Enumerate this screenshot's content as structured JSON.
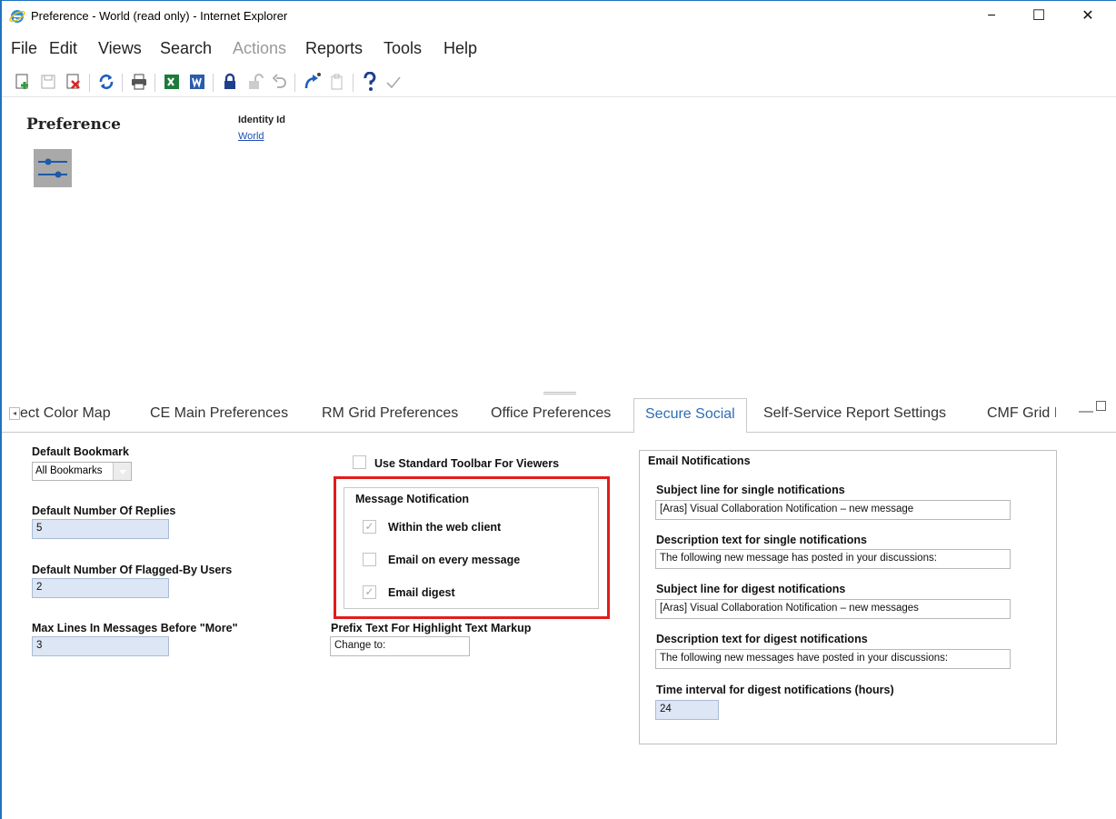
{
  "window": {
    "title": "Preference - World (read only) - Internet Explorer",
    "minimize": "−",
    "maximize": "☐",
    "close": "✕"
  },
  "menu": {
    "file": "File",
    "edit": "Edit",
    "views": "Views",
    "search": "Search",
    "actions": "Actions",
    "reports": "Reports",
    "tools": "Tools",
    "help": "Help"
  },
  "header": {
    "title": "Preference",
    "identity_label": "Identity Id",
    "identity_value": "World"
  },
  "tabs": [
    {
      "label": "ect Color Map"
    },
    {
      "label": "CE Main Preferences"
    },
    {
      "label": "RM Grid Preferences"
    },
    {
      "label": "Office Preferences"
    },
    {
      "label": "Secure Social",
      "active": true
    },
    {
      "label": "Self-Service Report Settings"
    },
    {
      "label": "CMF Grid I"
    }
  ],
  "pane_controls": {
    "minimize": "—"
  },
  "form": {
    "default_bookmark": {
      "label": "Default Bookmark",
      "value": "All Bookmarks"
    },
    "default_replies": {
      "label": "Default Number Of Replies",
      "value": "5"
    },
    "default_flagged": {
      "label": "Default Number Of Flagged-By Users",
      "value": "2"
    },
    "max_lines": {
      "label": "Max Lines In Messages Before \"More\"",
      "value": "3"
    },
    "use_standard_toolbar": {
      "label": "Use Standard Toolbar For Viewers",
      "checked": false
    },
    "message_notification": {
      "label": "Message Notification",
      "within_web_client": {
        "label": "Within the web client",
        "checked": true
      },
      "email_every_message": {
        "label": "Email on every message",
        "checked": false
      },
      "email_digest": {
        "label": "Email digest",
        "checked": true
      }
    },
    "prefix_text": {
      "label": "Prefix Text For Highlight Text Markup",
      "value": "Change to:"
    },
    "email_notifications": {
      "label": "Email Notifications",
      "subject_single": {
        "label": "Subject line for single notifications",
        "value": "[Aras] Visual Collaboration Notification – new message"
      },
      "desc_single": {
        "label": "Description text for single notifications",
        "value": "The following new message has posted in your discussions:"
      },
      "subject_digest": {
        "label": "Subject line for digest notifications",
        "value": "[Aras] Visual Collaboration Notification – new messages"
      },
      "desc_digest": {
        "label": "Description text for digest notifications",
        "value": "The following new messages have posted in your discussions:"
      },
      "interval": {
        "label": "Time interval for digest notifications (hours)",
        "value": "24"
      }
    }
  },
  "colors": {
    "accent": "#2f6db4",
    "field_bg": "#dce6f4",
    "highlight": "#e31b1b"
  }
}
